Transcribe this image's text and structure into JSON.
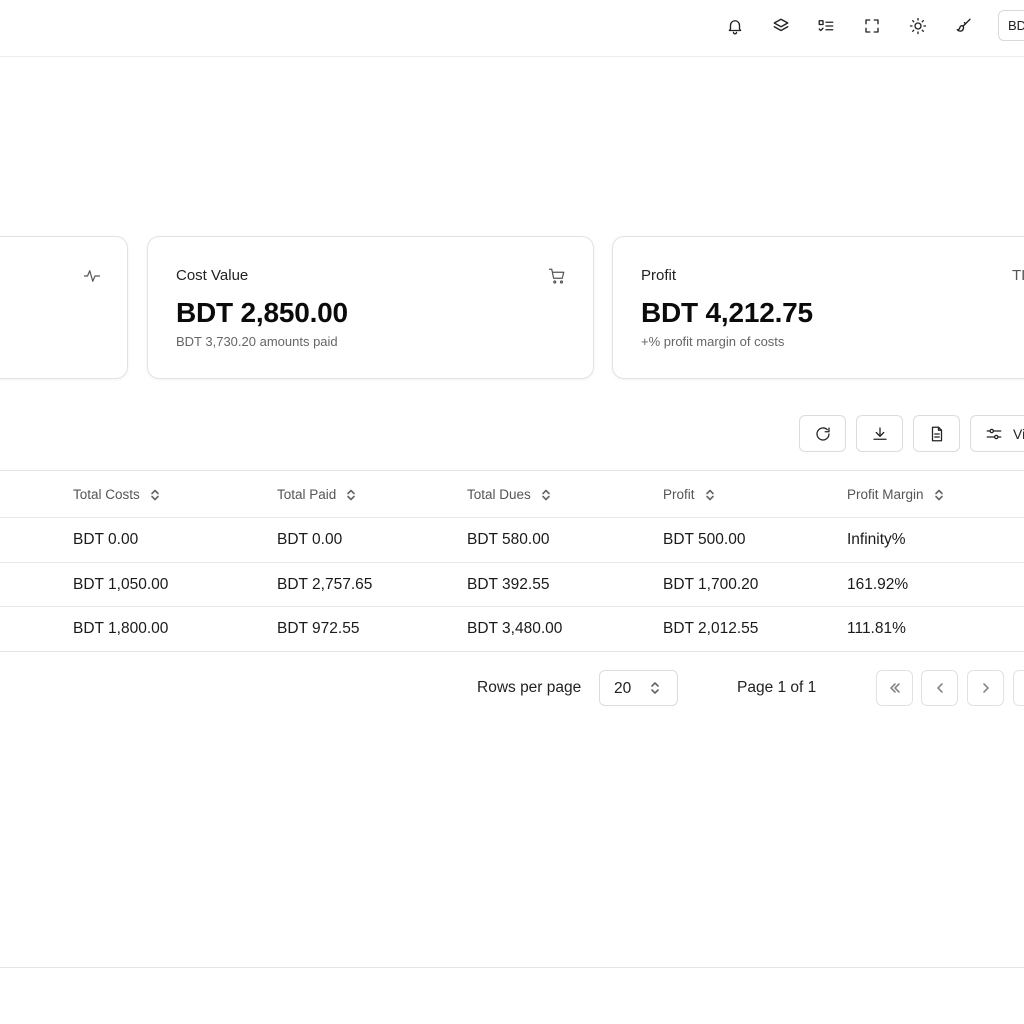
{
  "header": {
    "icons": [
      "bell-icon",
      "layers-icon",
      "checklist-icon",
      "fullscreen-icon",
      "sun-icon",
      "paintbrush-icon"
    ],
    "currency_label": "BDT"
  },
  "cards": {
    "first": {
      "icon": "activity-icon"
    },
    "cost": {
      "title": "Cost Value",
      "value": "BDT 2,850.00",
      "sub": "BDT 3,730.20 amounts paid",
      "icon": "cart-icon"
    },
    "profit": {
      "title": "Profit",
      "value": "BDT 4,212.75",
      "sub": "+% profit margin of costs",
      "icon_text": "TI"
    }
  },
  "toolbar": {
    "icons": [
      "refresh-icon",
      "download-icon",
      "document-icon",
      "sliders-icon"
    ],
    "view_label": "View"
  },
  "table": {
    "columns": [
      "Total Costs",
      "Total Paid",
      "Total Dues",
      "Profit",
      "Profit Margin"
    ],
    "rows": [
      [
        "BDT 0.00",
        "BDT 0.00",
        "BDT 580.00",
        "BDT 500.00",
        "Infinity%"
      ],
      [
        "BDT 1,050.00",
        "BDT 2,757.65",
        "BDT 392.55",
        "BDT 1,700.20",
        "161.92%"
      ],
      [
        "BDT 1,800.00",
        "BDT 972.55",
        "BDT 3,480.00",
        "BDT 2,012.55",
        "111.81%"
      ]
    ]
  },
  "pagination": {
    "rows_per_page_label": "Rows per page",
    "rows_per_page_value": "20",
    "page_info": "Page 1 of 1"
  }
}
